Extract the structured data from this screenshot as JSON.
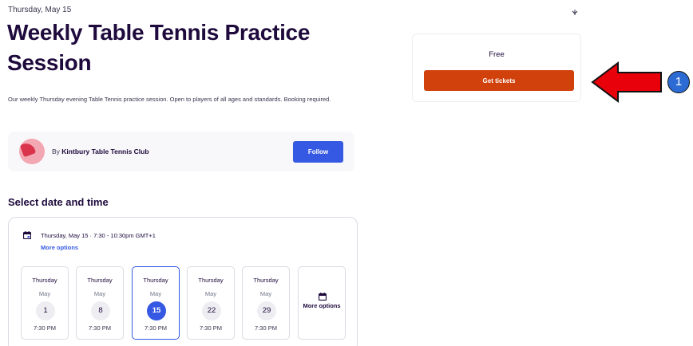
{
  "event": {
    "date_line": "Thursday, May 15",
    "title": "Weekly Table Tennis Practice Session",
    "summary": "Our weekly Thursday evening Table Tennis practice session. Open to players of all ages and standards. Booking required."
  },
  "organizer": {
    "by_label": "By",
    "name": "Kintbury Table Tennis Club",
    "follow_label": "Follow"
  },
  "schedule": {
    "section_title": "Select date and time",
    "selected_text": "Thursday, May 15 · 7:30 - 10:30pm GMT+1",
    "more_options_link": "More options",
    "dates": [
      {
        "weekday": "Thursday",
        "month": "May",
        "day": "1",
        "time": "7:30 PM"
      },
      {
        "weekday": "Thursday",
        "month": "May",
        "day": "8",
        "time": "7:30 PM"
      },
      {
        "weekday": "Thursday",
        "month": "May",
        "day": "15",
        "time": "7:30 PM"
      },
      {
        "weekday": "Thursday",
        "month": "May",
        "day": "22",
        "time": "7:30 PM"
      },
      {
        "weekday": "Thursday",
        "month": "May",
        "day": "29",
        "time": "7:30 PM"
      }
    ],
    "more_tile_label": "More options",
    "selected_day": "15"
  },
  "tickets": {
    "price": "Free",
    "button_label": "Get tickets"
  },
  "annotation": {
    "badge": "1",
    "arrow_color": "#e8000b"
  },
  "colors": {
    "brand_orange": "#d1410c",
    "accent_blue": "#3659e3",
    "heading": "#1e0a3c"
  },
  "icons": [
    "calendar-icon",
    "share-icon",
    "arrow-left-icon"
  ]
}
